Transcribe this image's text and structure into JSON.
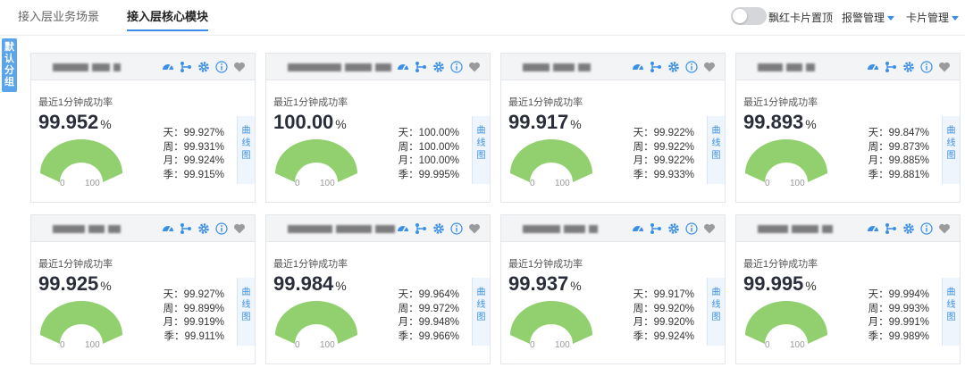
{
  "tabs": [
    {
      "label": "接入层业务场景"
    },
    {
      "label": "接入层核心模块"
    }
  ],
  "toolbar": {
    "toggle_label": "飘红卡片置顶",
    "alarm_menu": "报警管理",
    "card_menu": "卡片管理"
  },
  "sidetab": {
    "chars": [
      "默",
      "认",
      "分",
      "组"
    ]
  },
  "colors": {
    "accent": "#3b8fe8",
    "gauge": "#92cf6e",
    "side_tab": "#5aa4ec"
  },
  "icons": [
    "dashboard-icon",
    "topology-icon",
    "gear-icon",
    "info-icon",
    "heart-icon"
  ],
  "cards": [
    {
      "rate_label": "最近1分钟成功率",
      "value": "99.952",
      "unit": "%",
      "gauge_min": "0",
      "gauge_max": "100",
      "day": "天：99.927%",
      "week": "周：99.931%",
      "month": "月：99.924%",
      "season": "季：99.915%",
      "curve": [
        "曲",
        "线",
        "图"
      ]
    },
    {
      "rate_label": "最近1分钟成功率",
      "value": "100.00",
      "unit": "%",
      "gauge_min": "0",
      "gauge_max": "100",
      "day": "天：100.00%",
      "week": "周：100.00%",
      "month": "月：100.00%",
      "season": "季：99.995%",
      "curve": [
        "曲",
        "线",
        "图"
      ]
    },
    {
      "rate_label": "最近1分钟成功率",
      "value": "99.917",
      "unit": "%",
      "gauge_min": "0",
      "gauge_max": "100",
      "day": "天：99.922%",
      "week": "周：99.922%",
      "month": "月：99.922%",
      "season": "季：99.933%",
      "curve": [
        "曲",
        "线",
        "图"
      ]
    },
    {
      "rate_label": "最近1分钟成功率",
      "value": "99.893",
      "unit": "%",
      "gauge_min": "0",
      "gauge_max": "100",
      "day": "天：99.847%",
      "week": "周：99.873%",
      "month": "月：99.885%",
      "season": "季：99.881%",
      "curve": [
        "曲",
        "线",
        "图"
      ]
    },
    {
      "rate_label": "最近1分钟成功率",
      "value": "99.925",
      "unit": "%",
      "gauge_min": "0",
      "gauge_max": "100",
      "day": "天：99.927%",
      "week": "周：99.899%",
      "month": "月：99.919%",
      "season": "季：99.911%",
      "curve": [
        "曲",
        "线",
        "图"
      ]
    },
    {
      "rate_label": "最近1分钟成功率",
      "value": "99.984",
      "unit": "%",
      "gauge_min": "0",
      "gauge_max": "100",
      "day": "天：99.964%",
      "week": "周：99.972%",
      "month": "月：99.948%",
      "season": "季：99.966%",
      "curve": [
        "曲",
        "线",
        "图"
      ]
    },
    {
      "rate_label": "最近1分钟成功率",
      "value": "99.937",
      "unit": "%",
      "gauge_min": "0",
      "gauge_max": "100",
      "day": "天：99.917%",
      "week": "周：99.920%",
      "month": "月：99.920%",
      "season": "季：99.924%",
      "curve": [
        "曲",
        "线",
        "图"
      ]
    },
    {
      "rate_label": "最近1分钟成功率",
      "value": "99.995",
      "unit": "%",
      "gauge_min": "0",
      "gauge_max": "100",
      "day": "天：99.994%",
      "week": "周：99.993%",
      "month": "月：99.991%",
      "season": "季：99.989%",
      "curve": [
        "曲",
        "线",
        "图"
      ]
    }
  ]
}
